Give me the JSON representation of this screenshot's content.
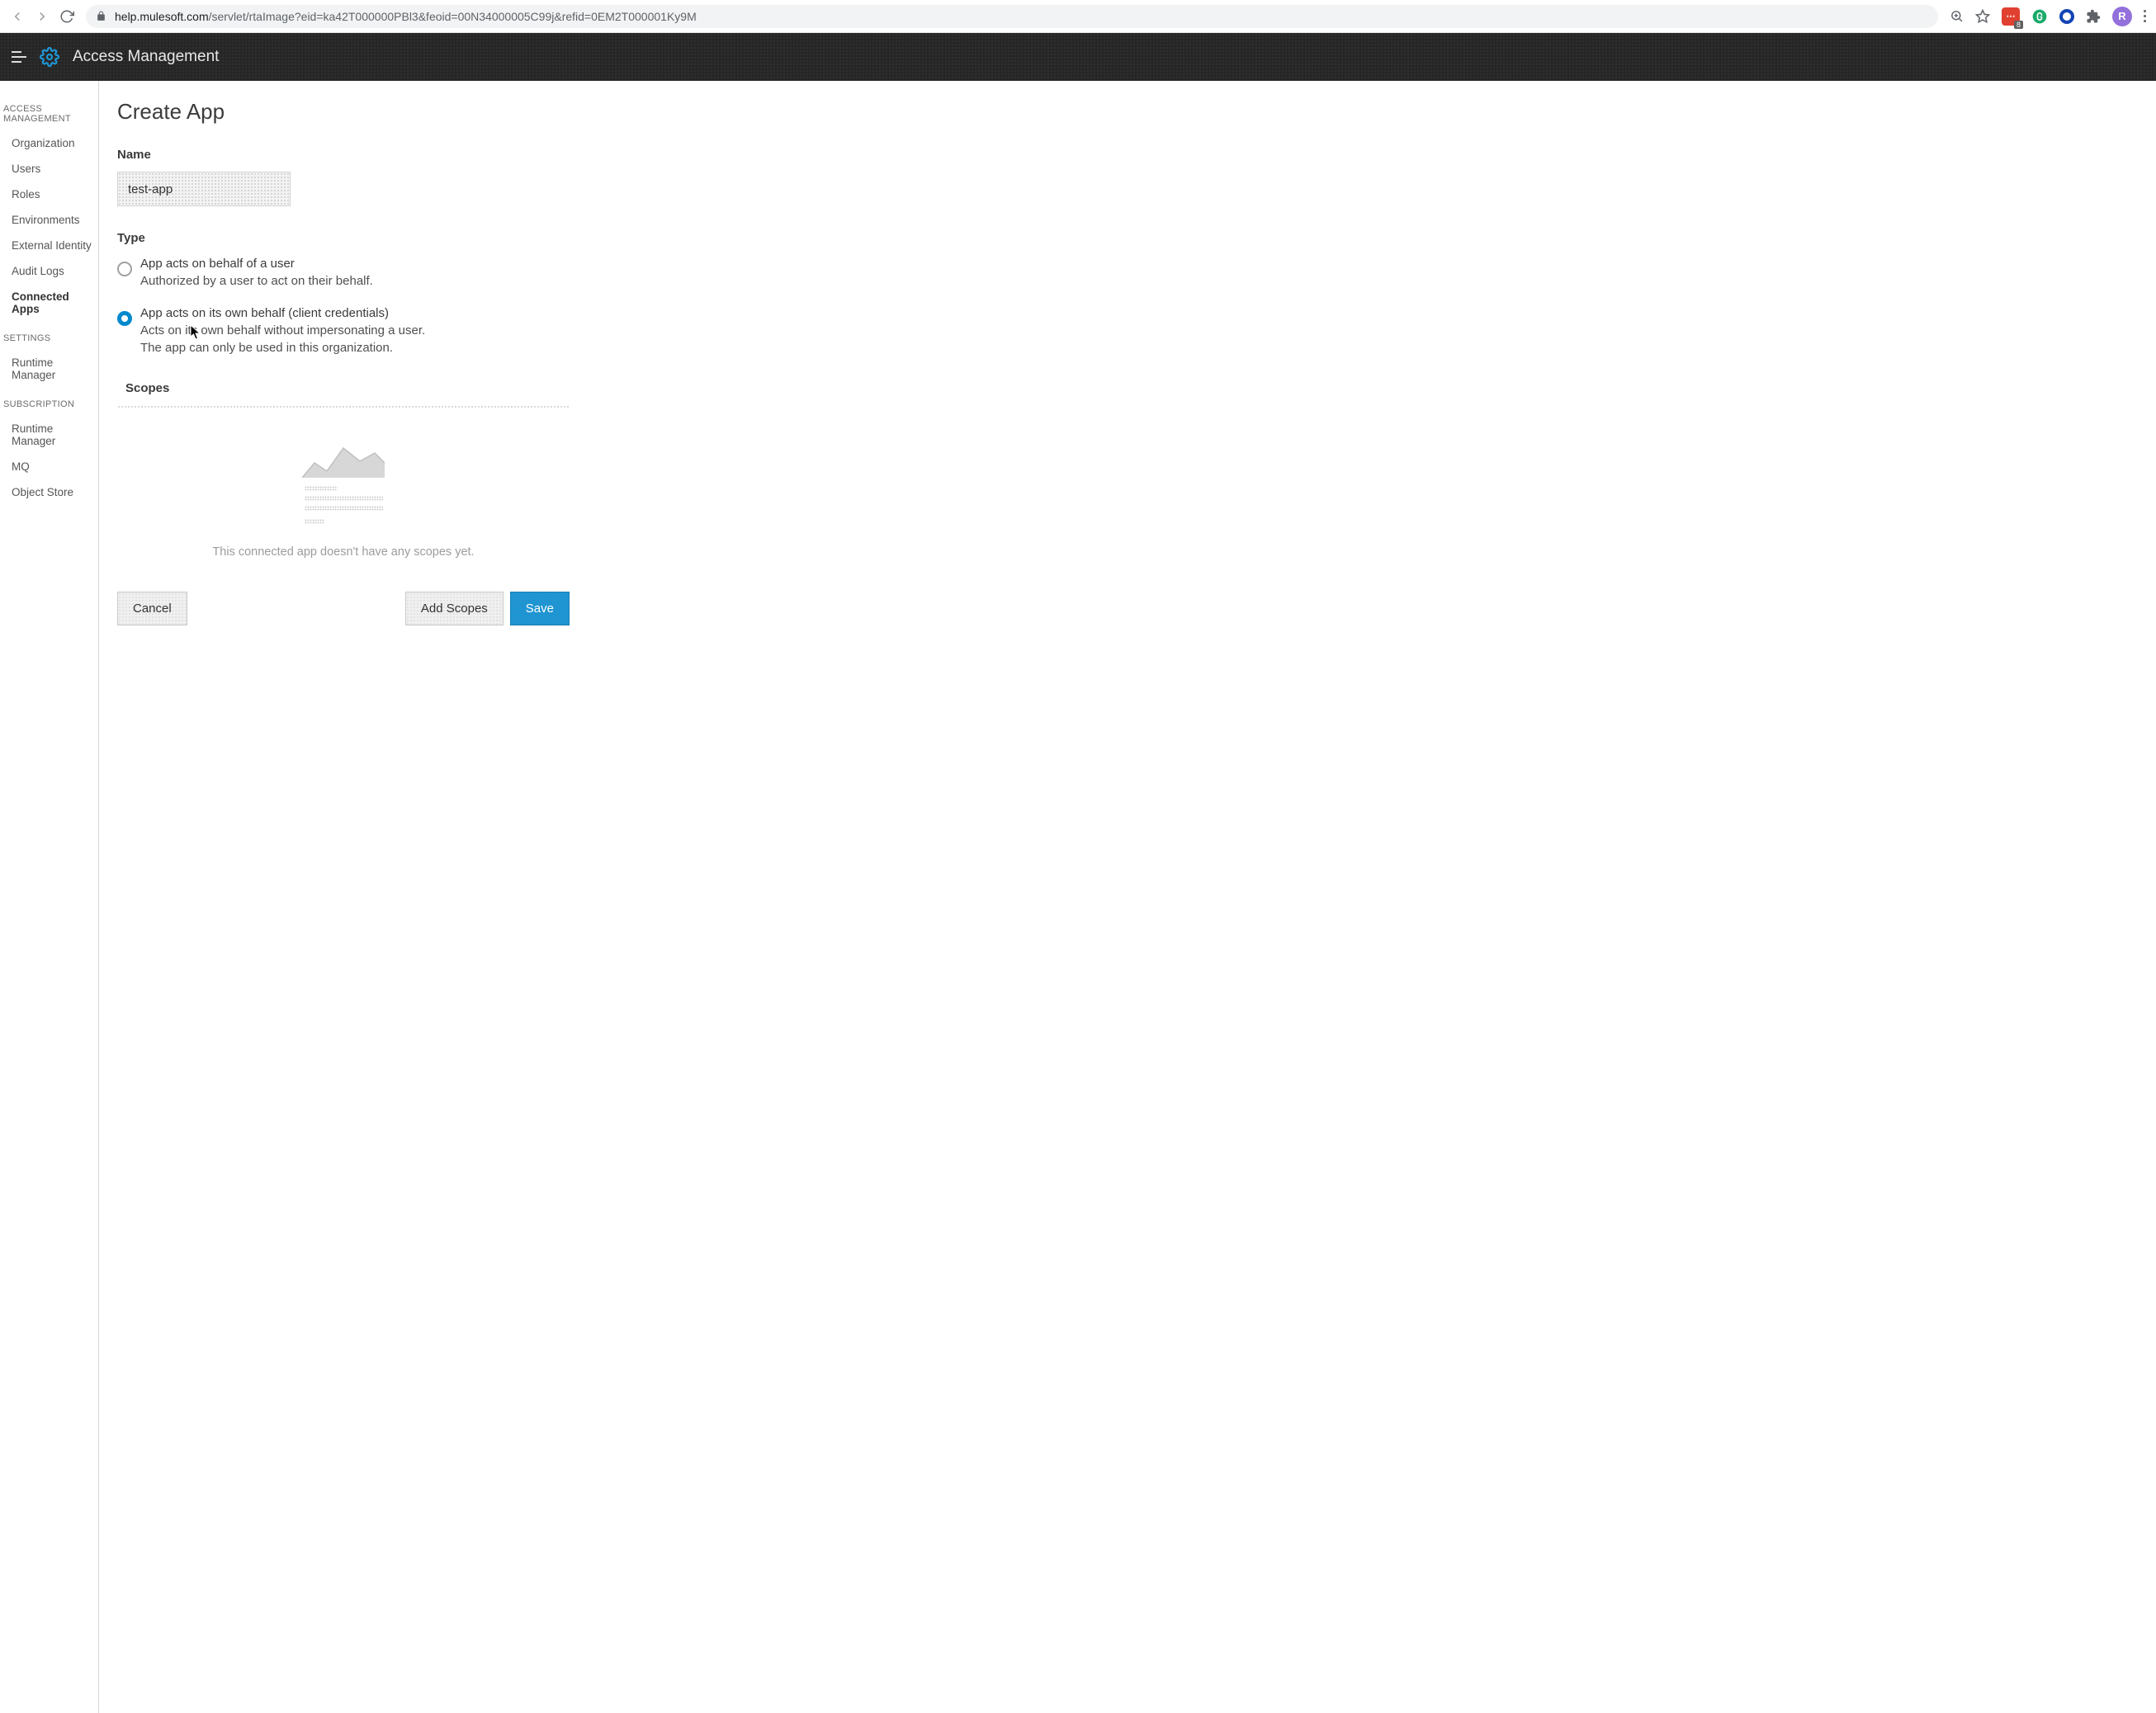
{
  "browser": {
    "url_host": "help.mulesoft.com",
    "url_path": "/servlet/rtaImage?eid=ka42T000000PBl3&feoid=00N34000005C99j&refid=0EM2T000001Ky9M",
    "ext_red_badge": "8",
    "avatar_letter": "R"
  },
  "header": {
    "title": "Access Management"
  },
  "sidebar": {
    "groups": [
      {
        "title": "ACCESS MANAGEMENT",
        "items": [
          "Organization",
          "Users",
          "Roles",
          "Environments",
          "External Identity",
          "Audit Logs",
          "Connected Apps"
        ],
        "active_index": 6
      },
      {
        "title": "SETTINGS",
        "items": [
          "Runtime Manager"
        ],
        "active_index": -1
      },
      {
        "title": "SUBSCRIPTION",
        "items": [
          "Runtime Manager",
          "MQ",
          "Object Store"
        ],
        "active_index": -1
      }
    ]
  },
  "main": {
    "page_title": "Create App",
    "name_label": "Name",
    "name_value": "test-app",
    "type_label": "Type",
    "radios": [
      {
        "title": "App acts on behalf of a user",
        "desc": "Authorized by a user to act on their behalf.",
        "selected": false
      },
      {
        "title": "App acts on its own behalf (client credentials)",
        "desc": "Acts on its own behalf without impersonating a user. The app can only be used in this organization.",
        "selected": true
      }
    ],
    "scopes_label": "Scopes",
    "empty_message": "This connected app doesn't have any scopes yet.",
    "buttons": {
      "cancel": "Cancel",
      "add_scopes": "Add Scopes",
      "save": "Save"
    }
  }
}
